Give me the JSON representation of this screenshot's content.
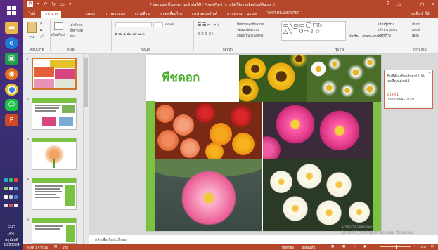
{
  "window": {
    "title": "7 ดอก.pptx [โหมดความเข้ากันได้] - PowerPoint (การเปิดใช้งานผลิตภัณฑ์ล้มเหลว)",
    "controls": [
      "?",
      "▭",
      "—",
      "◻",
      "✕"
    ]
  },
  "ribbon_tabs": [
    "ไฟล์",
    "หน้าแรก",
    "แทรก",
    "การออกแบบ",
    "การเปลี่ยน",
    "ภาพเคลื่อนไหว",
    "การนำเสนอสไลด์",
    "ตรวจทาน",
    "มุมมอง",
    "FOXIT READER PDF"
  ],
  "active_tab": "หน้าแรก",
  "signin": "ลงชื่อเข้าใช้",
  "ribbon": {
    "paste": "วาง",
    "clipboard": "คลิปบอร์ด",
    "new_slide": "สไลด์ใหม่",
    "layout": "เค้าโครง",
    "reset": "ตั้งค่าใหม่",
    "section": "ส่วน",
    "slides_group": "สไลด์",
    "font_group": "ฟอนต์",
    "paragraph_group": "ย่อหน้า",
    "text_direction": "ทิศทางของข้อความ",
    "align_text": "จัดแนวข้อความ",
    "smartart": "แปลงเป็น SmartArt",
    "drawing_group": "รูปวาด",
    "arrange": "จัดเรียง",
    "quick_styles": "ลักษณะด่วน",
    "shape_fill": "เติมสีรูปร่าง",
    "shape_outline": "เค้าร่างรูปร่าง",
    "shape_effects": "ผลรูปร่าง",
    "find": "ค้นหา",
    "replace": "แทนที่",
    "select": "เลือก",
    "editing_group": "การแก้ไข",
    "font_buttons": "B  I  U  S  abc  AV  Aa  A"
  },
  "thumbnails": [
    {
      "num": "1",
      "selected": true
    },
    {
      "num": "2",
      "selected": false
    },
    {
      "num": "3",
      "selected": false
    },
    {
      "num": "4",
      "selected": false
    },
    {
      "num": "5",
      "selected": false
    }
  ],
  "slide": {
    "title": "พืชดอก",
    "photo_names": [
      "sunflowers",
      "white daisies",
      "orange roses and red flowers",
      "pink dahlias",
      "pink lotus",
      "white plumeria"
    ]
  },
  "comment": {
    "text": "ยินดีต้อนรับกลับมา! ไปยังจุดที่คุณค้างไว้",
    "slide_ref": "สไลด์ 1",
    "date": "13/9/2564 - 11:21"
  },
  "notes_placeholder": "คลิกเพื่อเพิ่มบันทึกย่อ",
  "status": {
    "slide_count": "สไลด์ 1 จาก 16",
    "lang": "ไทย",
    "notes": "บันทึกย่อ",
    "comments": "ข้อคิดเห็น",
    "zoom": "74 %"
  },
  "watermark": {
    "line1": "Activate Windows",
    "line2": "Go to PC settings to activate Windows."
  },
  "tray": {
    "lang": "ENG",
    "time": "14:47",
    "day": "พฤหัสบดี",
    "date": "16/9/2564"
  },
  "colors": {
    "accent": "#b7472a",
    "title_green": "#4caf2e",
    "bar_green": "#7cc242"
  }
}
